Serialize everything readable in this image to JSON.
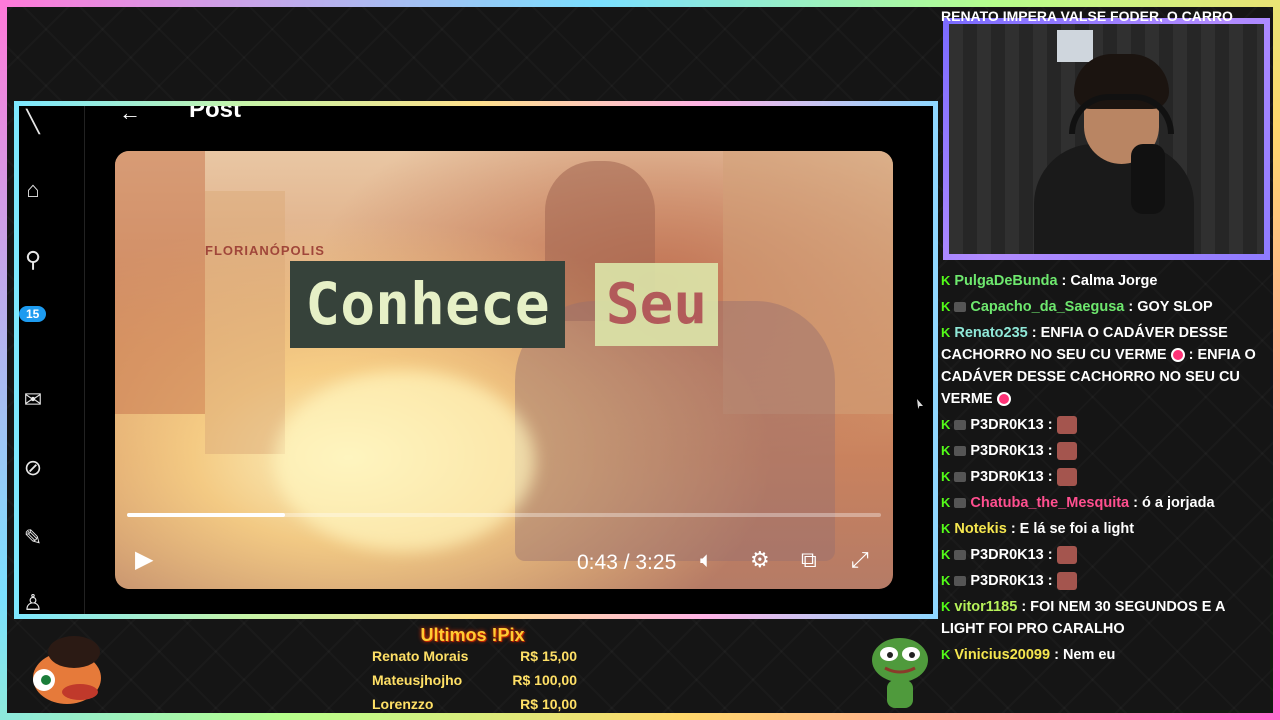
{
  "chat_top_text": "RENATO IMPERA VALSE FODER, O CARRO",
  "post": {
    "title": "Post",
    "notification_count": "15"
  },
  "video": {
    "caption_1": "Conhece",
    "caption_2": "Seu",
    "sign_text": "FLORIANÓPOLIS",
    "time": "0:43 / 3:25",
    "progress": 0.21
  },
  "chat": [
    {
      "user": "PulgaDeBunda",
      "color": "u-green",
      "text": ": Calma Jorge"
    },
    {
      "user": "Capacho_da_Saegusa",
      "color": "u-green",
      "text": ": GOY SLOP"
    },
    {
      "user": "Renato235",
      "color": "u-teal",
      "text": ": ENFIA O CADÁVER DESSE CACHORRO NO SEU CU VERME",
      "long": true
    },
    {
      "user": "P3DR0K13",
      "color": "",
      "text": ":",
      "emote": true
    },
    {
      "user": "P3DR0K13",
      "color": "",
      "text": ":",
      "emote": true
    },
    {
      "user": "P3DR0K13",
      "color": "",
      "text": ":",
      "emote": true
    },
    {
      "user": "Chatuba_the_Mesquita",
      "color": "u-pink",
      "text": ": ó a jorjada"
    },
    {
      "user": "Notekis",
      "color": "u-yellow",
      "text": ": E lá se foi a light"
    },
    {
      "user": "P3DR0K13",
      "color": "",
      "text": ":",
      "emote": true
    },
    {
      "user": "P3DR0K13",
      "color": "",
      "text": ":",
      "emote": true
    },
    {
      "user": "vitor1185",
      "color": "u-lime",
      "text": ": FOI NEM 30 SEGUNDOS E A LIGHT FOI PRO CARALHO"
    },
    {
      "user": "Vinicius20099",
      "color": "u-yellow",
      "text": ": Nem eu"
    }
  ],
  "pix": {
    "title": "Ultimos !Pix",
    "rows": [
      {
        "name": "Renato Morais",
        "amount": "R$ 15,00"
      },
      {
        "name": "Mateusjhojho",
        "amount": "R$ 100,00"
      },
      {
        "name": "Lorenzzo",
        "amount": "R$ 10,00"
      }
    ]
  }
}
